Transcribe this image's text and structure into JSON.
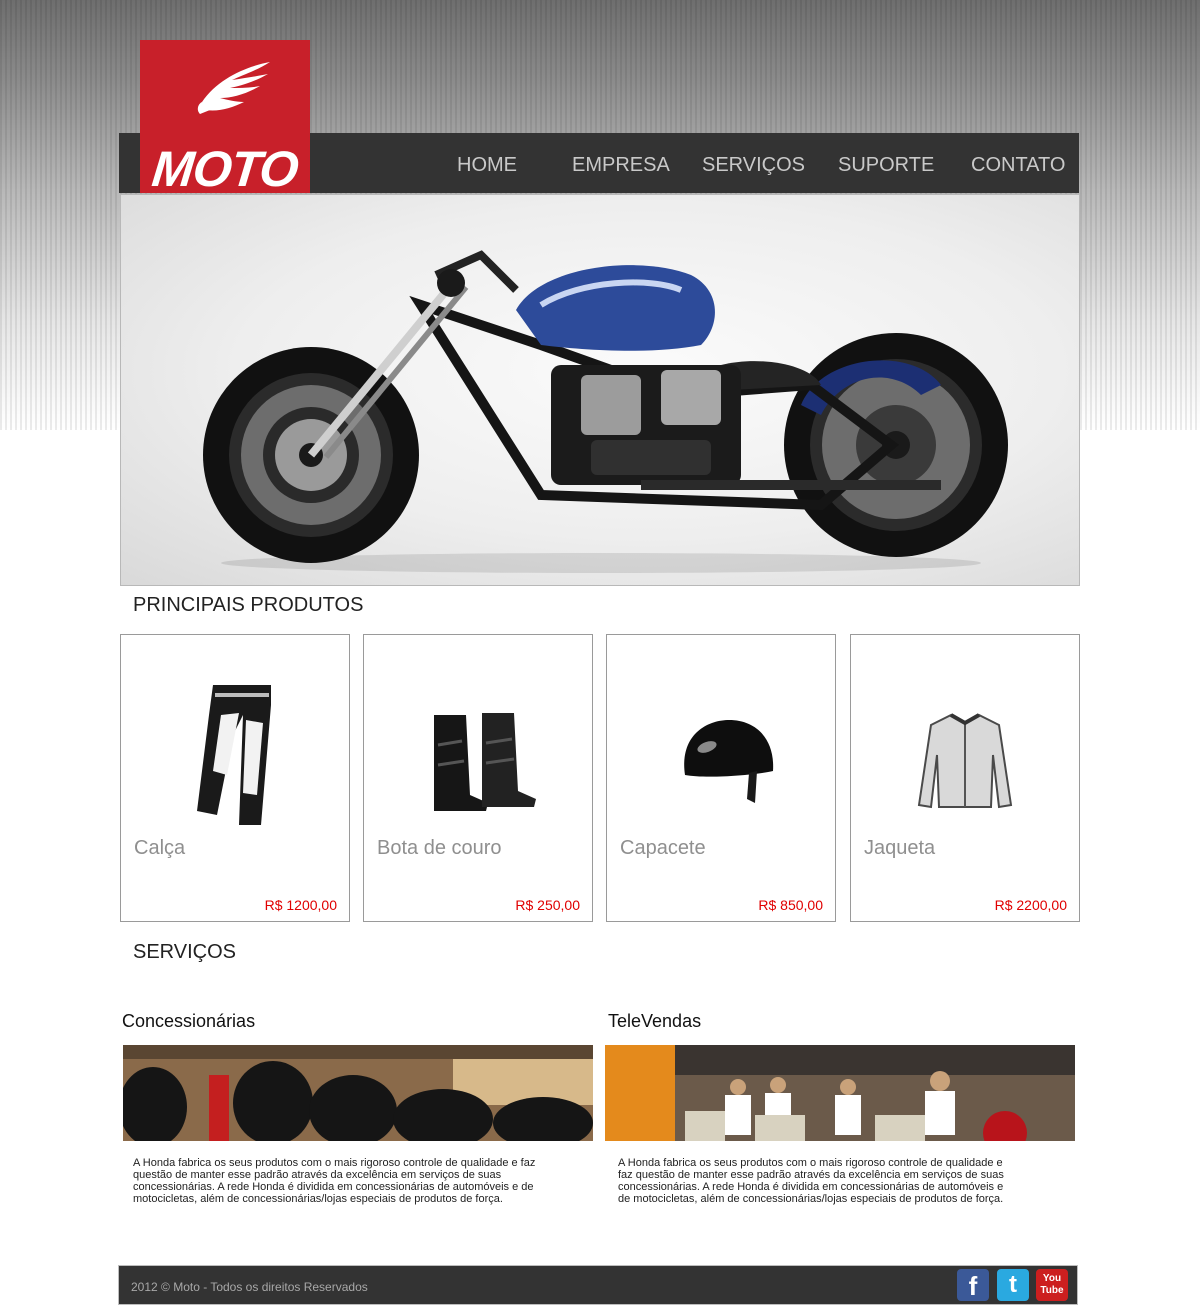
{
  "brand": {
    "logo_text": "MOTO"
  },
  "nav": {
    "items": [
      {
        "label": "HOME"
      },
      {
        "label": "EMPRESA"
      },
      {
        "label": "SERVIÇOS"
      },
      {
        "label": "SUPORTE"
      },
      {
        "label": "CONTATO"
      }
    ]
  },
  "hero": {
    "image_icon": "motorcycle-photo"
  },
  "products": {
    "title": "PRINCIPAIS PRODUTOS",
    "items": [
      {
        "name": "Calça",
        "price": "R$ 1200,00",
        "image_icon": "pants-photo"
      },
      {
        "name": "Bota de couro",
        "price": "R$ 250,00",
        "image_icon": "boots-photo"
      },
      {
        "name": "Capacete",
        "price": "R$ 850,00",
        "image_icon": "helmet-photo"
      },
      {
        "name": "Jaqueta",
        "price": "R$ 2200,00",
        "image_icon": "jacket-photo"
      }
    ]
  },
  "services": {
    "title": "SERVIÇOS",
    "items": [
      {
        "title": "Concessionárias",
        "image_icon": "tires-store-photo",
        "text_lines": [
          "A Honda fabrica os seus produtos com o mais rigoroso controle de qualidade e faz",
          "questão de manter esse padrão através da excelência em serviços de suas",
          "concessionárias. A rede Honda é dividida em concessionárias de automóveis e de",
          "motocicletas, além de concessionárias/lojas especiais de produtos de força."
        ]
      },
      {
        "title": "TeleVendas",
        "image_icon": "call-center-photo",
        "text_lines": [
          "A Honda fabrica os seus produtos com o mais rigoroso controle de qualidade e",
          "faz questão de manter esse padrão através da excelência em serviços de suas",
          "concessionárias. A rede Honda é dividida em concessionárias de automóveis e",
          "de motocicletas, além de concessionárias/lojas especiais de produtos de força."
        ]
      }
    ]
  },
  "footer": {
    "copyright": "2012 © Moto - Todos os direitos Reservados",
    "social": [
      {
        "icon": "facebook-icon",
        "glyph": "f"
      },
      {
        "icon": "twitter-icon",
        "glyph": "t"
      },
      {
        "icon": "youtube-icon",
        "glyph": "You\nTube"
      }
    ]
  },
  "colors": {
    "brand_red": "#c8202a",
    "nav_bg": "#333333",
    "nav_text": "#c9c9c9",
    "price_red": "#e00000",
    "product_name_gray": "#8f8f8f",
    "facebook_blue": "#3b5998",
    "twitter_blue": "#2aa9e0",
    "youtube_red": "#cc1f1f"
  }
}
